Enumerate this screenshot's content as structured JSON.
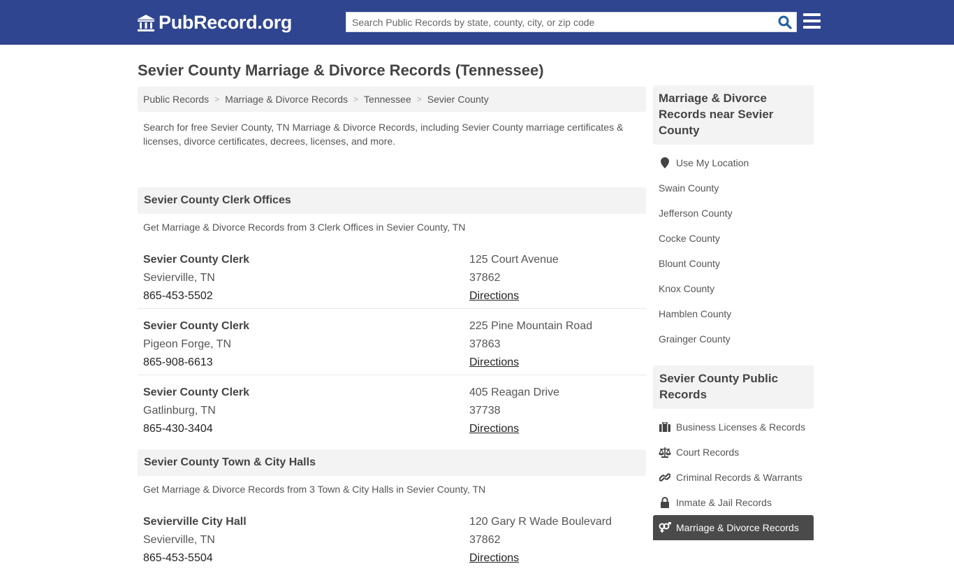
{
  "header": {
    "logo_text": "PubRecord.org",
    "search_placeholder": "Search Public Records by state, county, city, or zip code",
    "colors": {
      "topbar": "#2f4590",
      "search_icon": "#1d5fa0"
    }
  },
  "page": {
    "title": "Sevier County Marriage & Divorce Records (Tennessee)",
    "breadcrumb": [
      "Public Records",
      "Marriage & Divorce Records",
      "Tennessee",
      "Sevier County"
    ],
    "breadcrumb_sep": ">",
    "intro": "Search for free Sevier County, TN Marriage & Divorce Records, including Sevier County marriage certificates & licenses, divorce certificates, decrees, licenses, and more."
  },
  "sections": [
    {
      "title": "Sevier County Clerk Offices",
      "subtitle": "Get Marriage & Divorce Records from 3 Clerk Offices in Sevier County, TN",
      "entries": [
        {
          "name": "Sevier County Clerk",
          "city": "Sevierville, TN",
          "phone": "865-453-5502",
          "address": "125 Court Avenue",
          "zip": "37862",
          "directions": "Directions"
        },
        {
          "name": "Sevier County Clerk",
          "city": "Pigeon Forge, TN",
          "phone": "865-908-6613",
          "address": "225 Pine Mountain Road",
          "zip": "37863",
          "directions": "Directions"
        },
        {
          "name": "Sevier County Clerk",
          "city": "Gatlinburg, TN",
          "phone": "865-430-3404",
          "address": "405 Reagan Drive",
          "zip": "37738",
          "directions": "Directions"
        }
      ]
    },
    {
      "title": "Sevier County Town & City Halls",
      "subtitle": "Get Marriage & Divorce Records from 3 Town & City Halls in Sevier County, TN",
      "entries": [
        {
          "name": "Sevierville City Hall",
          "city": "Sevierville, TN",
          "phone": "865-453-5504",
          "address": "120 Gary R Wade Boulevard",
          "zip": "37862",
          "directions": "Directions"
        }
      ]
    }
  ],
  "sidebar": {
    "nearby_title": "Marriage & Divorce Records near Sevier County",
    "use_location": "Use My Location",
    "nearby": [
      "Swain County",
      "Jefferson County",
      "Cocke County",
      "Blount County",
      "Knox County",
      "Hamblen County",
      "Grainger County"
    ],
    "public_title": "Sevier County Public Records",
    "public_links": [
      {
        "label": "Business Licenses & Records",
        "icon": "briefcase-icon"
      },
      {
        "label": "Court Records",
        "icon": "scale-icon"
      },
      {
        "label": "Criminal Records & Warrants",
        "icon": "link-icon"
      },
      {
        "label": "Inmate & Jail Records",
        "icon": "lock-icon"
      },
      {
        "label": "Marriage & Divorce Records",
        "icon": "gender-icon",
        "active": true
      }
    ]
  }
}
